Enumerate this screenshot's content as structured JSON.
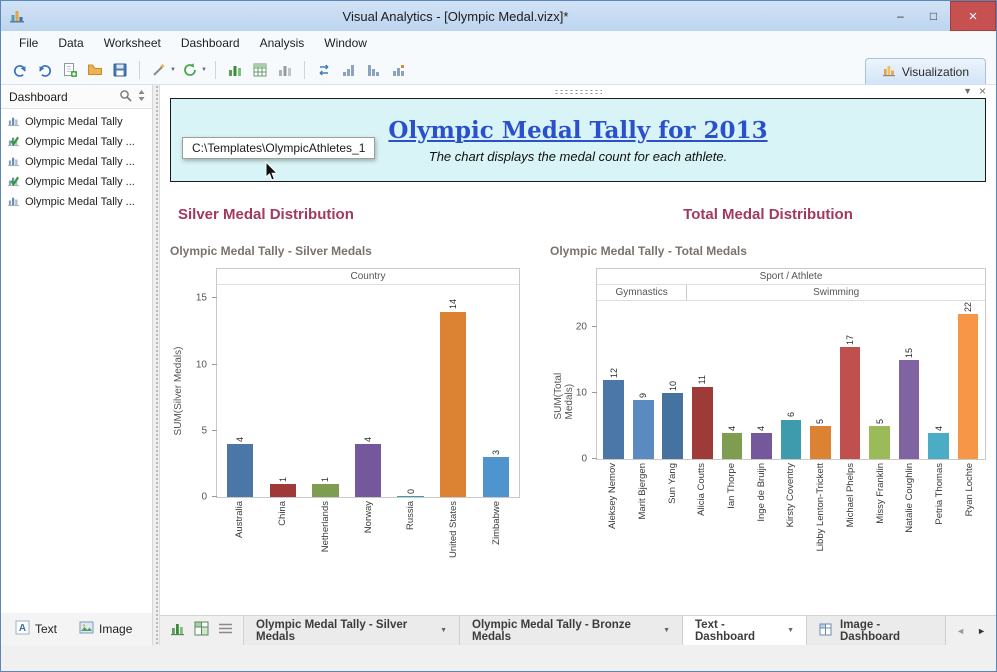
{
  "window": {
    "title": "Visual Analytics - [Olympic Medal.vizx]*"
  },
  "icons": {
    "chevron_down": "▼",
    "minimize": "–",
    "maximize": "□",
    "close": "×",
    "check": "✓",
    "nav_prev": "◄",
    "nav_next": "►",
    "widget_menu": "▼",
    "widget_close": "×"
  },
  "menu": {
    "items": [
      "File",
      "Data",
      "Worksheet",
      "Dashboard",
      "Analysis",
      "Window"
    ]
  },
  "toolbar": {
    "visualization_label": "Visualization"
  },
  "sidebar": {
    "title": "Dashboard",
    "items": [
      {
        "label": "Olympic Medal Tally",
        "checked": false
      },
      {
        "label": "Olympic Medal Tally ...",
        "checked": true
      },
      {
        "label": "Olympic Medal Tally ...",
        "checked": false
      },
      {
        "label": "Olympic Medal Tally ...",
        "checked": true
      },
      {
        "label": "Olympic Medal Tally ...",
        "checked": false
      }
    ],
    "tools": {
      "text_label": "Text",
      "image_label": "Image"
    }
  },
  "canvas": {
    "text_widget": {
      "title": "Olympic Medal Tally for 2013",
      "subtitle": "The chart displays the medal count for each athlete."
    },
    "tooltip_text": "C:\\Templates\\OlympicAthletes_1",
    "sections": [
      {
        "header": "Silver Medal Distribution"
      },
      {
        "header": "Total Medal Distribution"
      }
    ]
  },
  "colors": {
    "section_header": "#a2395f",
    "widget_title_blue": "#2a50cc",
    "widget_background": "#d9f4f6",
    "close_button_red": "#c75050"
  },
  "chart_data": [
    {
      "type": "bar",
      "title": "Olympic Medal Tally - Silver Medals",
      "column_header": "Country",
      "ylabel": "SUM(Silver Medals)",
      "yticks": [
        0,
        5,
        10,
        15
      ],
      "ylim": [
        0,
        16
      ],
      "grid": false,
      "categories": [
        "Australia",
        "China",
        "Netherlands",
        "Norway",
        "Russia",
        "United States",
        "Zimbabwe"
      ],
      "values": [
        4,
        1,
        1,
        4,
        0,
        14,
        3
      ],
      "colors": [
        "#4a76a8",
        "#9e3b39",
        "#7e9d50",
        "#75589c",
        "#3d9bad",
        "#dc8333",
        "#4f94cd"
      ]
    },
    {
      "type": "bar",
      "title": "Olympic Medal Tally - Total Medals",
      "column_header": "Sport / Athlete",
      "groups": [
        {
          "label": "Gymnastics",
          "span": 3
        },
        {
          "label": "Swimming",
          "span": 10
        }
      ],
      "ylabel": "SUM(Total Medals)",
      "yticks": [
        0,
        10,
        20
      ],
      "ylim": [
        0,
        24
      ],
      "grid": false,
      "categories": [
        "Aleksey Nemov",
        "Marit Bjergen",
        "Sun Yang",
        "Alicia Coutts",
        "Ian Thorpe",
        "Inge de Bruijn",
        "Kirsty Coventry",
        "Libby Lenton-Trickett",
        "Michael Phelps",
        "Missy Franklin",
        "Natalie Coughlin",
        "Petria Thomas",
        "Ryan Lochte"
      ],
      "values": [
        12,
        9,
        10,
        11,
        4,
        4,
        6,
        5,
        17,
        5,
        15,
        4,
        22
      ],
      "colors": [
        "#4a76a8",
        "#5b8ac0",
        "#45729e",
        "#9e3b39",
        "#7e9d50",
        "#75589c",
        "#3d9bad",
        "#dc8333",
        "#c0504d",
        "#9bbb59",
        "#8064a2",
        "#4bacc6",
        "#f79646"
      ]
    }
  ],
  "tabbar": {
    "tabs": [
      {
        "label": "Olympic Medal Tally - Silver Medals",
        "active": false,
        "has_menu": true,
        "icon": null
      },
      {
        "label": "Olympic Medal Tally - Bronze Medals",
        "active": false,
        "has_menu": true,
        "icon": null
      },
      {
        "label": "Text - Dashboard",
        "active": true,
        "has_menu": true,
        "icon": null
      },
      {
        "label": "Image - Dashboard",
        "active": false,
        "has_menu": false,
        "icon": "grid"
      }
    ]
  }
}
